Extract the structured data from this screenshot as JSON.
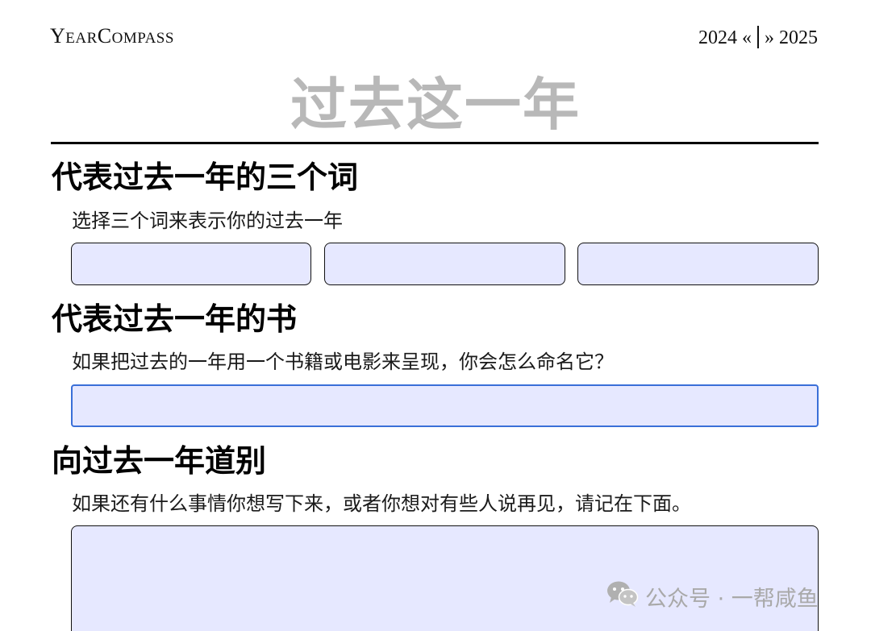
{
  "header": {
    "brand_initial_1": "Y",
    "brand_rest_1": "ear",
    "brand_initial_2": "C",
    "brand_rest_2": "ompass",
    "year_prev": "2024 «",
    "year_next": "» 2025"
  },
  "page_title": "过去这一年",
  "sections": [
    {
      "heading": "代表过去一年的三个词",
      "prompt": "选择三个词来表示你的过去一年",
      "fields": [
        "",
        "",
        ""
      ]
    },
    {
      "heading": "代表过去一年的书",
      "prompt": "如果把过去的一年用一个书籍或电影来呈现，你会怎么命名它？",
      "fields": [
        ""
      ]
    },
    {
      "heading": "向过去一年道别",
      "prompt": "如果还有什么事情你想写下来，或者你想对有些人说再见，请记在下面。",
      "fields": [
        ""
      ]
    }
  ],
  "watermark": {
    "icon": "wechat-icon",
    "text": "公众号 · 一帮咸鱼"
  },
  "colors": {
    "field_fill": "#e6e8ff",
    "title_gray": "#b8b8b8",
    "focus_border": "#3a6fd8"
  }
}
